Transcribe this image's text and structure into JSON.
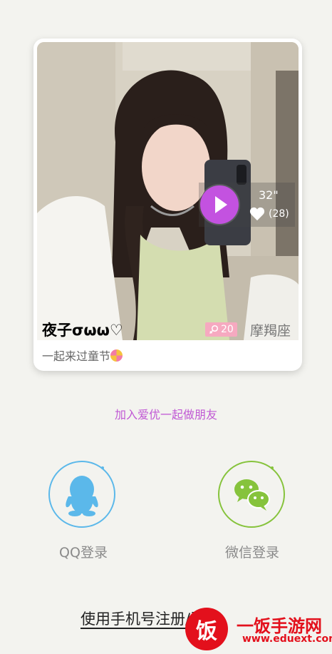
{
  "profile": {
    "name": "夜子σωω♡",
    "age": "20",
    "zodiac": "摩羯座",
    "signature": "一起来过童节",
    "video_duration": "32\"",
    "likes": "(28)"
  },
  "tagline": "加入爱优一起做朋友",
  "login": {
    "qq_label": "QQ登录",
    "wechat_label": "微信登录",
    "phone_label": "使用手机号注册/登录"
  },
  "watermark": {
    "badge": "饭",
    "title": "一饭手游网",
    "url": "www.eduext.com"
  },
  "colors": {
    "accent": "#c058d4",
    "play": "#c352e0",
    "qq": "#5bb8ea",
    "wechat": "#86c33c",
    "age_badge": "#f6a9c0"
  }
}
